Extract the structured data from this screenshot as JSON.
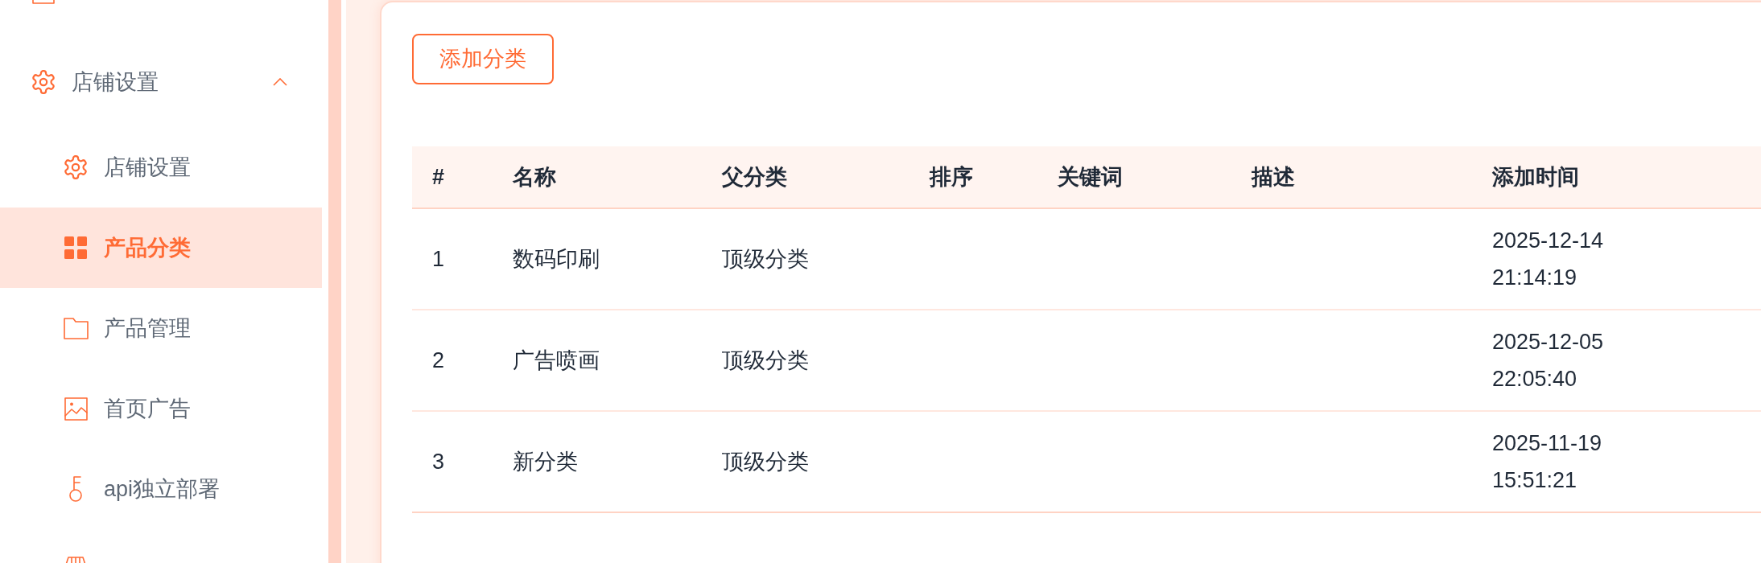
{
  "sidebar": {
    "items": [
      {
        "label": "店铺设置",
        "expanded": true,
        "children": [
          {
            "label": "店铺设置",
            "selected": false
          },
          {
            "label": "产品分类",
            "selected": true
          },
          {
            "label": "产品管理",
            "selected": false
          },
          {
            "label": "首页广告",
            "selected": false
          },
          {
            "label": "api独立部署",
            "selected": false
          }
        ]
      }
    ]
  },
  "toolbar": {
    "add_button": "添加分类"
  },
  "table": {
    "columns": [
      "#",
      "名称",
      "父分类",
      "排序",
      "关键词",
      "描述",
      "添加时间"
    ],
    "rows": [
      {
        "index": "1",
        "name": "数码印刷",
        "parent": "顶级分类",
        "added_at": "2025-12-14 21:14:19"
      },
      {
        "index": "2",
        "name": "广告喷画",
        "parent": "顶级分类",
        "added_at": "2025-12-05 22:05:40"
      },
      {
        "index": "3",
        "name": "新分类",
        "parent": "顶级分类",
        "added_at": "2025-11-19 15:51:21"
      }
    ]
  }
}
